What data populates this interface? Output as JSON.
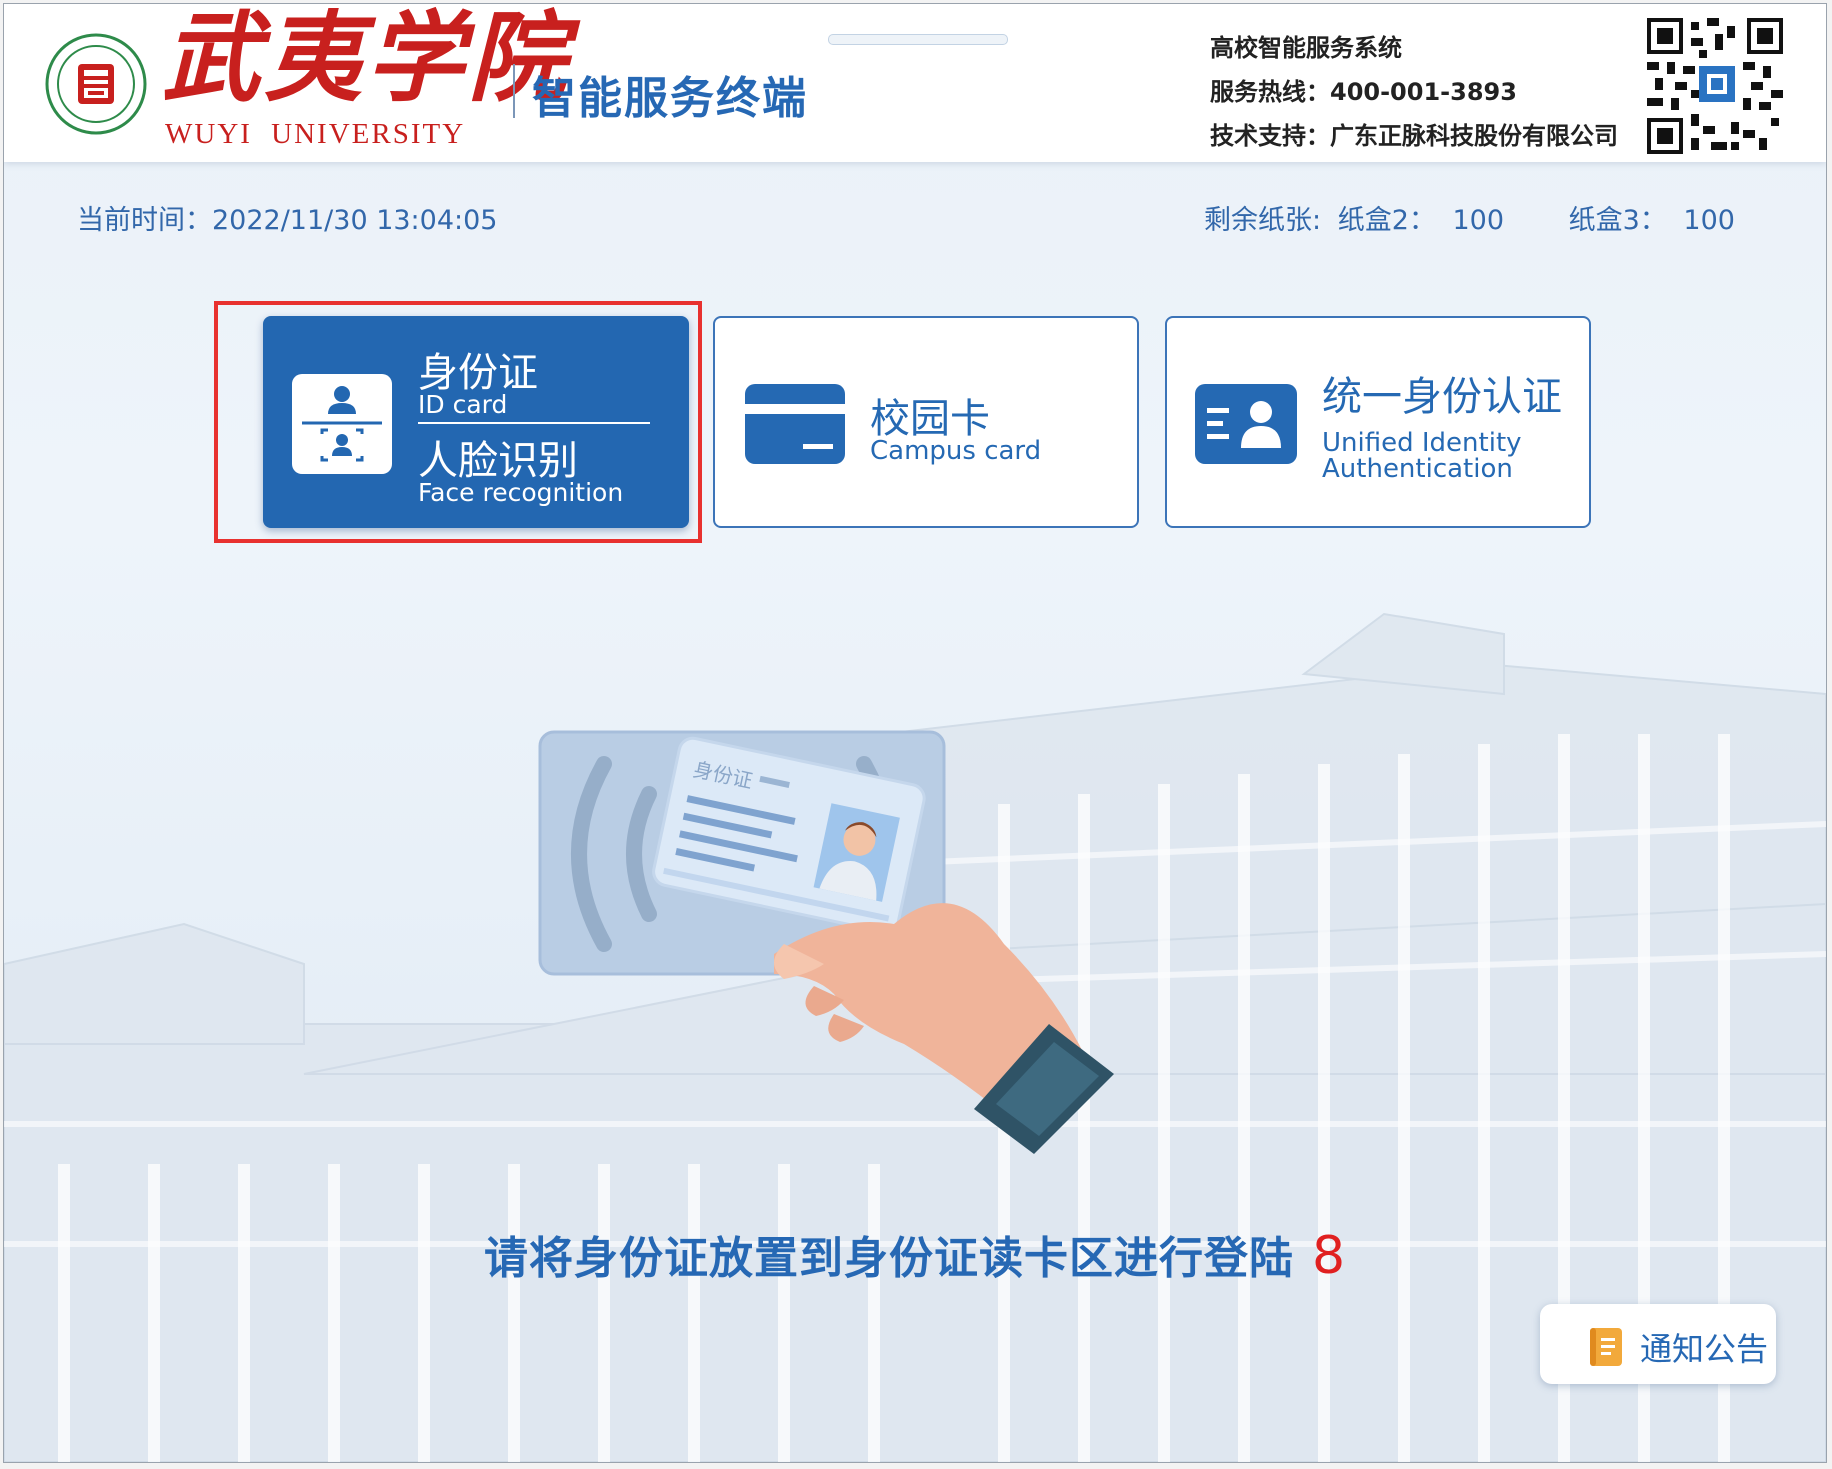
{
  "header": {
    "logo_cn": "武夷学院",
    "logo_en": "WUYI UNIVERSITY",
    "terminal_title": "智能服务终端",
    "info_system": "高校智能服务系统",
    "info_hotline": "服务热线：400-001-3893",
    "info_support": "技术支持：广东正脉科技股份有限公司"
  },
  "status": {
    "time": "当前时间：2022/11/30 13:04:05",
    "paper_label": "剩余纸张:",
    "tray2_label": "纸盒2：",
    "tray2_value": "100",
    "tray3_label": "纸盒3：",
    "tray3_value": "100"
  },
  "tiles": [
    {
      "cn": "身份证",
      "en": "ID card",
      "cn2": "人脸识别",
      "en2": "Face recognition",
      "selected": true
    },
    {
      "cn": "校园卡",
      "en": "Campus card",
      "selected": false
    },
    {
      "cn": "统一身份认证",
      "en": "Unified Identity",
      "en_line2": "Authentication",
      "selected": false
    }
  ],
  "illustration": {
    "card_text": "身份证"
  },
  "prompt": {
    "text": "请将身份证放置到身份证读卡区进行登陆",
    "countdown": "8"
  },
  "notice": {
    "label": "通知公告"
  },
  "colors": {
    "brand_blue": "#2367b1",
    "logo_red": "#c8201e",
    "countdown_red": "#e02020",
    "highlight_red": "#e8312f"
  },
  "icons": [
    "university-seal-icon",
    "qr-code-icon",
    "id-person-icon",
    "face-scan-icon",
    "campus-card-icon",
    "unified-identity-icon",
    "notice-document-icon"
  ]
}
